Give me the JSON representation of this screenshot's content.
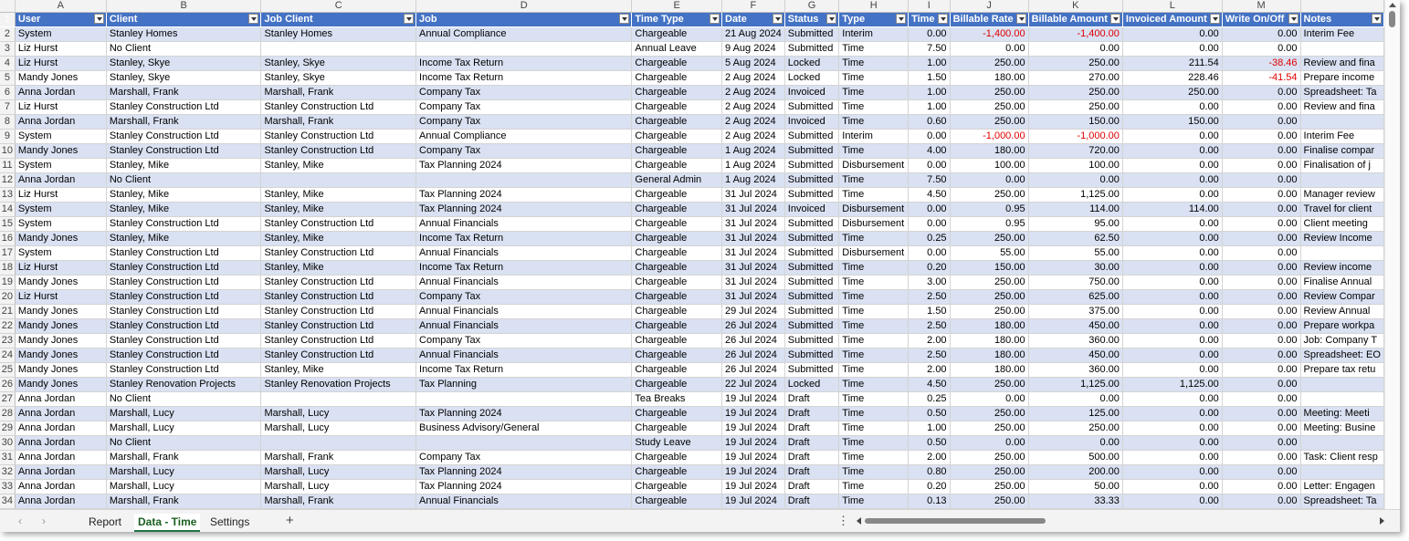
{
  "columns": [
    "A",
    "B",
    "C",
    "D",
    "E",
    "F",
    "G",
    "H",
    "I",
    "J",
    "K",
    "L",
    "M",
    ""
  ],
  "headers": [
    "User",
    "Client",
    "Job Client",
    "Job",
    "Time Type",
    "Date",
    "Status",
    "Type",
    "Time",
    "Billable Rate",
    "Billable Amount",
    "Invoiced Amount",
    "Write On/Off",
    "Notes"
  ],
  "rows": [
    {
      "n": "2",
      "c": [
        "System",
        "Stanley Homes",
        "Stanley Homes",
        "Annual Compliance",
        "Chargeable",
        "21 Aug 2024",
        "Submitted",
        "Interim",
        "0.00",
        "-1,400.00",
        "-1,400.00",
        "0.00",
        "0.00",
        "Interim Fee"
      ]
    },
    {
      "n": "3",
      "c": [
        "Liz Hurst",
        "No Client",
        "",
        "",
        "Annual Leave",
        "9 Aug 2024",
        "Submitted",
        "Time",
        "7.50",
        "0.00",
        "0.00",
        "0.00",
        "0.00",
        ""
      ]
    },
    {
      "n": "4",
      "c": [
        "Liz Hurst",
        "Stanley, Skye",
        "Stanley, Skye",
        "Income Tax Return",
        "Chargeable",
        "5 Aug 2024",
        "Locked",
        "Time",
        "1.00",
        "250.00",
        "250.00",
        "211.54",
        "-38.46",
        "Review and fina"
      ]
    },
    {
      "n": "5",
      "c": [
        "Mandy Jones",
        "Stanley, Skye",
        "Stanley, Skye",
        "Income Tax Return",
        "Chargeable",
        "2 Aug 2024",
        "Locked",
        "Time",
        "1.50",
        "180.00",
        "270.00",
        "228.46",
        "-41.54",
        "Prepare income"
      ]
    },
    {
      "n": "6",
      "c": [
        "Anna Jordan",
        "Marshall, Frank",
        "Marshall, Frank",
        "Company Tax",
        "Chargeable",
        "2 Aug 2024",
        "Invoiced",
        "Time",
        "1.00",
        "250.00",
        "250.00",
        "250.00",
        "0.00",
        "Spreadsheet: Ta"
      ]
    },
    {
      "n": "7",
      "c": [
        "Liz Hurst",
        "Stanley Construction Ltd",
        "Stanley Construction Ltd",
        "Company Tax",
        "Chargeable",
        "2 Aug 2024",
        "Submitted",
        "Time",
        "1.00",
        "250.00",
        "250.00",
        "0.00",
        "0.00",
        "Review and fina"
      ]
    },
    {
      "n": "8",
      "c": [
        "Anna Jordan",
        "Marshall, Frank",
        "Marshall, Frank",
        "Company Tax",
        "Chargeable",
        "2 Aug 2024",
        "Invoiced",
        "Time",
        "0.60",
        "250.00",
        "150.00",
        "150.00",
        "0.00",
        ""
      ]
    },
    {
      "n": "9",
      "c": [
        "System",
        "Stanley Construction Ltd",
        "Stanley Construction Ltd",
        "Annual Compliance",
        "Chargeable",
        "2 Aug 2024",
        "Submitted",
        "Interim",
        "0.00",
        "-1,000.00",
        "-1,000.00",
        "0.00",
        "0.00",
        "Interim Fee"
      ]
    },
    {
      "n": "10",
      "c": [
        "Mandy Jones",
        "Stanley Construction Ltd",
        "Stanley Construction Ltd",
        "Company Tax",
        "Chargeable",
        "1 Aug 2024",
        "Submitted",
        "Time",
        "4.00",
        "180.00",
        "720.00",
        "0.00",
        "0.00",
        "Finalise compar"
      ]
    },
    {
      "n": "11",
      "c": [
        "System",
        "Stanley, Mike",
        "Stanley, Mike",
        "Tax Planning 2024",
        "Chargeable",
        "1 Aug 2024",
        "Submitted",
        "Disbursement",
        "0.00",
        "100.00",
        "100.00",
        "0.00",
        "0.00",
        "Finalisation of j"
      ]
    },
    {
      "n": "12",
      "c": [
        "Anna Jordan",
        "No Client",
        "",
        "",
        "General Admin",
        "1 Aug 2024",
        "Submitted",
        "Time",
        "7.50",
        "0.00",
        "0.00",
        "0.00",
        "0.00",
        ""
      ]
    },
    {
      "n": "13",
      "c": [
        "Liz Hurst",
        "Stanley, Mike",
        "Stanley, Mike",
        "Tax Planning 2024",
        "Chargeable",
        "31 Jul 2024",
        "Submitted",
        "Time",
        "4.50",
        "250.00",
        "1,125.00",
        "0.00",
        "0.00",
        "Manager review"
      ]
    },
    {
      "n": "14",
      "c": [
        "System",
        "Stanley, Mike",
        "Stanley, Mike",
        "Tax Planning 2024",
        "Chargeable",
        "31 Jul 2024",
        "Invoiced",
        "Disbursement",
        "0.00",
        "0.95",
        "114.00",
        "114.00",
        "0.00",
        "Travel for client"
      ]
    },
    {
      "n": "15",
      "c": [
        "System",
        "Stanley Construction Ltd",
        "Stanley Construction Ltd",
        "Annual Financials",
        "Chargeable",
        "31 Jul 2024",
        "Submitted",
        "Disbursement",
        "0.00",
        "0.95",
        "95.00",
        "0.00",
        "0.00",
        "Client meeting"
      ]
    },
    {
      "n": "16",
      "c": [
        "Mandy Jones",
        "Stanley, Mike",
        "Stanley, Mike",
        "Income Tax Return",
        "Chargeable",
        "31 Jul 2024",
        "Submitted",
        "Time",
        "0.25",
        "250.00",
        "62.50",
        "0.00",
        "0.00",
        "Review Income"
      ]
    },
    {
      "n": "17",
      "c": [
        "System",
        "Stanley Construction Ltd",
        "Stanley Construction Ltd",
        "Annual Financials",
        "Chargeable",
        "31 Jul 2024",
        "Submitted",
        "Disbursement",
        "0.00",
        "55.00",
        "55.00",
        "0.00",
        "0.00",
        ""
      ]
    },
    {
      "n": "18",
      "c": [
        "Liz Hurst",
        "Stanley Construction Ltd",
        "Stanley, Mike",
        "Income Tax Return",
        "Chargeable",
        "31 Jul 2024",
        "Submitted",
        "Time",
        "0.20",
        "150.00",
        "30.00",
        "0.00",
        "0.00",
        "Review income"
      ]
    },
    {
      "n": "19",
      "c": [
        "Mandy Jones",
        "Stanley Construction Ltd",
        "Stanley Construction Ltd",
        "Annual Financials",
        "Chargeable",
        "31 Jul 2024",
        "Submitted",
        "Time",
        "3.00",
        "250.00",
        "750.00",
        "0.00",
        "0.00",
        "Finalise Annual"
      ]
    },
    {
      "n": "20",
      "c": [
        "Liz Hurst",
        "Stanley Construction Ltd",
        "Stanley Construction Ltd",
        "Company Tax",
        "Chargeable",
        "31 Jul 2024",
        "Submitted",
        "Time",
        "2.50",
        "250.00",
        "625.00",
        "0.00",
        "0.00",
        "Review Compar"
      ]
    },
    {
      "n": "21",
      "c": [
        "Mandy Jones",
        "Stanley Construction Ltd",
        "Stanley Construction Ltd",
        "Annual Financials",
        "Chargeable",
        "29 Jul 2024",
        "Submitted",
        "Time",
        "1.50",
        "250.00",
        "375.00",
        "0.00",
        "0.00",
        "Review Annual"
      ]
    },
    {
      "n": "22",
      "c": [
        "Mandy Jones",
        "Stanley Construction Ltd",
        "Stanley Construction Ltd",
        "Annual Financials",
        "Chargeable",
        "26 Jul 2024",
        "Submitted",
        "Time",
        "2.50",
        "180.00",
        "450.00",
        "0.00",
        "0.00",
        "Prepare workpa"
      ]
    },
    {
      "n": "23",
      "c": [
        "Mandy Jones",
        "Stanley Construction Ltd",
        "Stanley Construction Ltd",
        "Company Tax",
        "Chargeable",
        "26 Jul 2024",
        "Submitted",
        "Time",
        "2.00",
        "180.00",
        "360.00",
        "0.00",
        "0.00",
        "Job: Company T"
      ]
    },
    {
      "n": "24",
      "c": [
        "Mandy Jones",
        "Stanley Construction Ltd",
        "Stanley Construction Ltd",
        "Annual Financials",
        "Chargeable",
        "26 Jul 2024",
        "Submitted",
        "Time",
        "2.50",
        "180.00",
        "450.00",
        "0.00",
        "0.00",
        "Spreadsheet: EO"
      ]
    },
    {
      "n": "25",
      "c": [
        "Mandy Jones",
        "Stanley Construction Ltd",
        "Stanley, Mike",
        "Income Tax Return",
        "Chargeable",
        "26 Jul 2024",
        "Submitted",
        "Time",
        "2.00",
        "180.00",
        "360.00",
        "0.00",
        "0.00",
        "Prepare tax retu"
      ]
    },
    {
      "n": "26",
      "c": [
        "Mandy Jones",
        "Stanley Renovation Projects",
        "Stanley Renovation Projects",
        "Tax Planning",
        "Chargeable",
        "22 Jul 2024",
        "Locked",
        "Time",
        "4.50",
        "250.00",
        "1,125.00",
        "1,125.00",
        "0.00",
        ""
      ]
    },
    {
      "n": "27",
      "c": [
        "Anna Jordan",
        "No Client",
        "",
        "",
        "Tea Breaks",
        "19 Jul 2024",
        "Draft",
        "Time",
        "0.25",
        "0.00",
        "0.00",
        "0.00",
        "0.00",
        ""
      ]
    },
    {
      "n": "28",
      "c": [
        "Anna Jordan",
        "Marshall, Lucy",
        "Marshall, Lucy",
        "Tax Planning 2024",
        "Chargeable",
        "19 Jul 2024",
        "Draft",
        "Time",
        "0.50",
        "250.00",
        "125.00",
        "0.00",
        "0.00",
        "Meeting: Meeti"
      ]
    },
    {
      "n": "29",
      "c": [
        "Anna Jordan",
        "Marshall, Lucy",
        "Marshall, Lucy",
        "Business Advisory/General",
        "Chargeable",
        "19 Jul 2024",
        "Draft",
        "Time",
        "1.00",
        "250.00",
        "250.00",
        "0.00",
        "0.00",
        "Meeting: Busine"
      ]
    },
    {
      "n": "30",
      "c": [
        "Anna Jordan",
        "No Client",
        "",
        "",
        "Study Leave",
        "19 Jul 2024",
        "Draft",
        "Time",
        "0.50",
        "0.00",
        "0.00",
        "0.00",
        "0.00",
        ""
      ]
    },
    {
      "n": "31",
      "c": [
        "Anna Jordan",
        "Marshall, Frank",
        "Marshall, Frank",
        "Company Tax",
        "Chargeable",
        "19 Jul 2024",
        "Draft",
        "Time",
        "2.00",
        "250.00",
        "500.00",
        "0.00",
        "0.00",
        "Task: Client resp"
      ]
    },
    {
      "n": "32",
      "c": [
        "Anna Jordan",
        "Marshall, Lucy",
        "Marshall, Lucy",
        "Tax Planning 2024",
        "Chargeable",
        "19 Jul 2024",
        "Draft",
        "Time",
        "0.80",
        "250.00",
        "200.00",
        "0.00",
        "0.00",
        ""
      ]
    },
    {
      "n": "33",
      "c": [
        "Anna Jordan",
        "Marshall, Lucy",
        "Marshall, Lucy",
        "Tax Planning 2024",
        "Chargeable",
        "19 Jul 2024",
        "Draft",
        "Time",
        "0.20",
        "250.00",
        "50.00",
        "0.00",
        "0.00",
        "Letter: Engagen"
      ]
    },
    {
      "n": "34",
      "c": [
        "Anna Jordan",
        "Marshall, Frank",
        "Marshall, Frank",
        "Annual Financials",
        "Chargeable",
        "19 Jul 2024",
        "Draft",
        "Time",
        "0.13",
        "250.00",
        "33.33",
        "0.00",
        "0.00",
        "Spreadsheet: Ta"
      ]
    }
  ],
  "header_row_number": "1",
  "sheet_tabs": [
    "Report",
    "Data - Time",
    "Settings"
  ],
  "active_tab": "Data - Time",
  "add_sheet_label": "+",
  "more_label": "⋮",
  "colors": {
    "header_bg": "#4472c4",
    "band": "#d9e1f2",
    "negative": "#e00000",
    "active_tab": "#217346"
  }
}
